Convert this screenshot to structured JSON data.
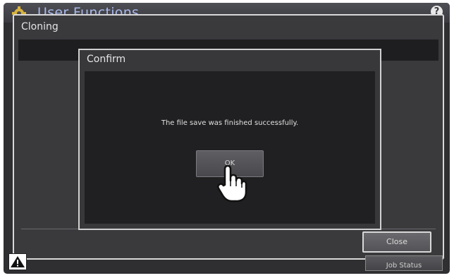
{
  "header": {
    "title": "User Functions",
    "help_label": "?"
  },
  "panel": {
    "title": "Cloning",
    "close_label": "Close"
  },
  "dialog": {
    "title": "Confirm",
    "message": "The file save was finished successfully.",
    "ok_label": "OK"
  },
  "footer": {
    "job_status_label": "Job Status"
  },
  "icons": {
    "settings": "gear-icon",
    "help": "help-icon",
    "pointer": "hand-pointer-icon",
    "warning": "warning-icon"
  }
}
